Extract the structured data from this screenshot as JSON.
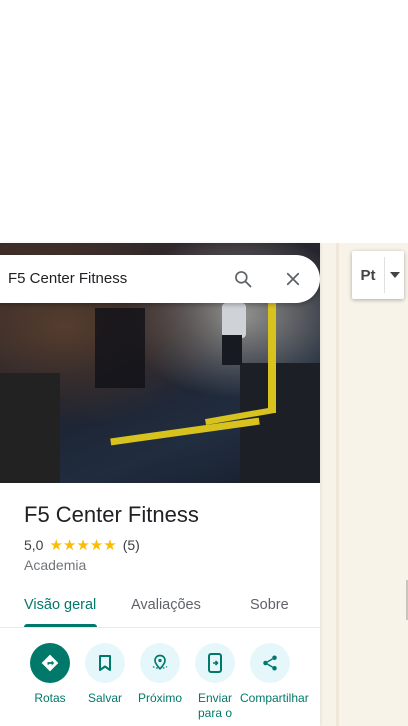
{
  "search": {
    "query": "F5 Center Fitness"
  },
  "place": {
    "name": "F5 Center Fitness",
    "rating": "5,0",
    "stars": "★★★★★",
    "review_count": "(5)",
    "category": "Academia"
  },
  "tabs": [
    {
      "label": "Visão geral",
      "active": true
    },
    {
      "label": "Avaliações",
      "active": false
    },
    {
      "label": "Sobre",
      "active": false
    }
  ],
  "actions": [
    {
      "label": "Rotas",
      "icon": "directions-icon"
    },
    {
      "label": "Salvar",
      "icon": "bookmark-icon"
    },
    {
      "label": "Próximo",
      "icon": "nearby-icon"
    },
    {
      "label": "Enviar para o",
      "icon": "send-to-phone-icon"
    },
    {
      "label": "Compartilhar",
      "icon": "share-icon"
    }
  ],
  "layers": {
    "label": "Pt"
  },
  "colors": {
    "accent": "#00796b",
    "star": "#fbbc04",
    "action_bg": "#e6f7fc"
  }
}
